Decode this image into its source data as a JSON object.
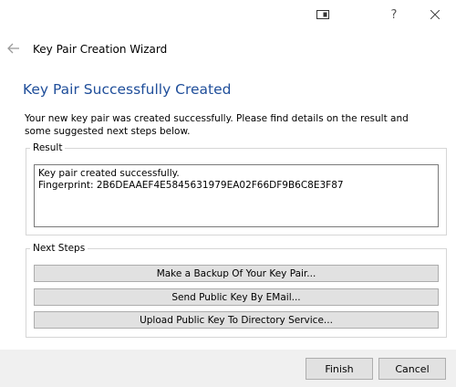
{
  "titlebar": {
    "help_label": "?"
  },
  "wizard": {
    "title": "Key Pair Creation Wizard"
  },
  "page": {
    "heading": "Key Pair Successfully Created",
    "intro": "Your new key pair was created successfully. Please find details on the result and some suggested next steps below."
  },
  "result": {
    "legend": "Result",
    "lines": [
      "Key pair created successfully.",
      "Fingerprint: 2B6DEAAEF4E5845631979EA02F66DF9B6C8E3F87"
    ]
  },
  "next_steps": {
    "legend": "Next Steps",
    "buttons": [
      "Make a Backup Of Your Key Pair...",
      "Send Public Key By EMail...",
      "Upload Public Key To Directory Service..."
    ]
  },
  "footer": {
    "finish_label": "Finish",
    "cancel_label": "Cancel"
  },
  "icons": {
    "snap": "snap-layout-icon",
    "close": "close-icon",
    "back": "back-arrow-icon"
  },
  "colors": {
    "heading": "#1f4e9a",
    "button_face": "#e1e1e1",
    "footer_bg": "#f0f0f0"
  }
}
